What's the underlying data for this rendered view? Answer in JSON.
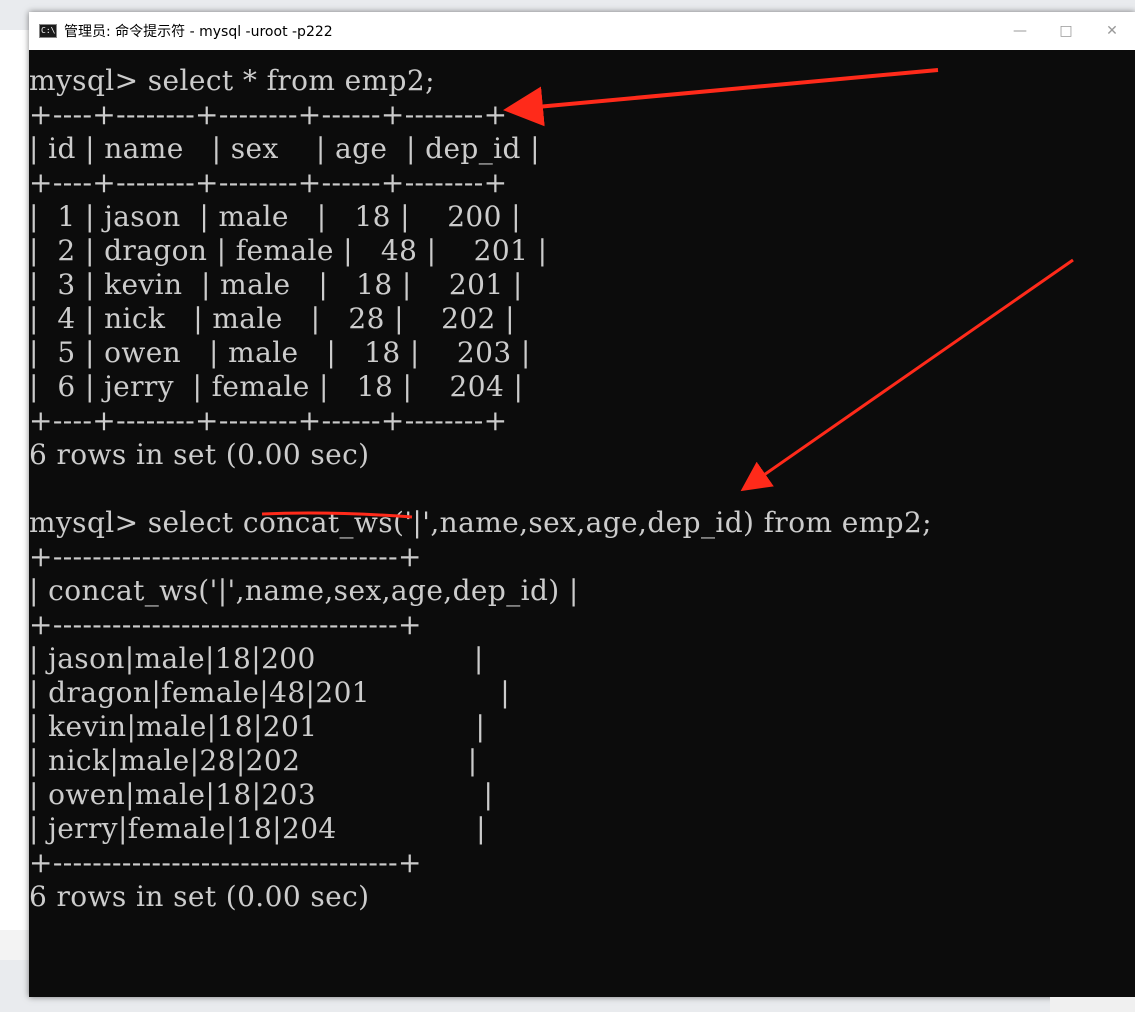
{
  "window": {
    "title": "管理员: 命令提示符 - mysql  -uroot -p222",
    "icon": "cmd-icon",
    "controls": [
      "minimize-icon",
      "maximize-icon",
      "close-icon"
    ]
  },
  "terminal": {
    "lines": [
      "mysql> select * from emp2;",
      "+----+--------+--------+------+--------+",
      "| id | name   | sex    | age  | dep_id |",
      "+----+--------+--------+------+--------+",
      "|  1 | jason  | male   |   18 |    200 |",
      "|  2 | dragon | female |   48 |    201 |",
      "|  3 | kevin  | male   |   18 |    201 |",
      "|  4 | nick   | male   |   28 |    202 |",
      "|  5 | owen   | male   |   18 |    203 |",
      "|  6 | jerry  | female |   18 |    204 |",
      "+----+--------+--------+------+--------+",
      "6 rows in set (0.00 sec)",
      "",
      "mysql> select concat_ws('|',name,sex,age,dep_id) from emp2;",
      "+-----------------------------------+",
      "| concat_ws('|',name,sex,age,dep_id) |",
      "+-----------------------------------+",
      "| jason|male|18|200                 |",
      "| dragon|female|48|201              |",
      "| kevin|male|18|201                 |",
      "| nick|male|28|202                  |",
      "| owen|male|18|203                  |",
      "| jerry|female|18|204               |",
      "+-----------------------------------+",
      "6 rows in set (0.00 sec)"
    ]
  },
  "colors": {
    "terminal_bg": "#0c0c0c",
    "terminal_text": "#cccccc",
    "annotation": "#ff2a1a",
    "titlebar_bg": "#ffffff"
  }
}
